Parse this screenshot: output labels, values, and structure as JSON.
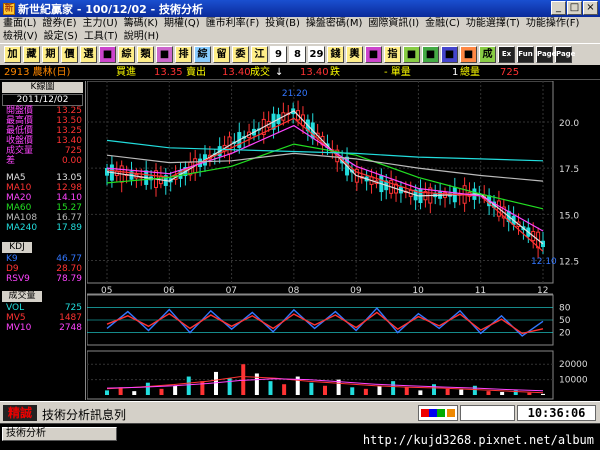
{
  "window": {
    "title": "新世紀贏家 - 100/12/02 - 技術分析",
    "app_icon": "app-icon",
    "controls": [
      "_",
      "□",
      "×"
    ]
  },
  "menu": {
    "row1": [
      "畫面(L)",
      "證券(E)",
      "主力(U)",
      "籌碼(K)",
      "期權(Q)",
      "匯市利率(F)",
      "投資(B)",
      "操盤密碼(M)",
      "國際資訊(I)",
      "金融(C)",
      "功能選擇(T)",
      "功能操作(F)"
    ],
    "row2": [
      "檢視(V)",
      "設定(S)",
      "工具(T)",
      "說明(H)"
    ]
  },
  "toolbar": [
    "加",
    "藏",
    "期",
    "價",
    "選",
    "■",
    "綜",
    "類",
    "■",
    "排",
    "綜",
    "留",
    "委",
    "江",
    "9",
    "8",
    "29",
    "錢",
    "輿",
    "■",
    "指",
    "■",
    "■",
    "■",
    "■",
    "成",
    "Ex",
    "Fun",
    "Page",
    "Page"
  ],
  "quote": {
    "code": "2913 農林(日)",
    "buy_label": "買進",
    "buy": "13.35",
    "sell_label": "賣出",
    "sell": "13.40",
    "last_label": "成交",
    "arrow": "↓",
    "last": "13.40",
    "change_label": "跌",
    "unit_label": "- 單量",
    "unit": "1",
    "vol_label": "總量",
    "volume": "725"
  },
  "panel": {
    "title": "K線圖",
    "date": "2011/12/02",
    "ohlc": [
      {
        "label": "開盤價",
        "value": "13.25"
      },
      {
        "label": "最高價",
        "value": "13.50"
      },
      {
        "label": "最低價",
        "value": "13.25"
      },
      {
        "label": "收盤價",
        "value": "13.40"
      },
      {
        "label": "成交量",
        "value": "725"
      },
      {
        "label": "差",
        "value": "0.00"
      }
    ],
    "ma": [
      {
        "label": "MA5",
        "value": "13.05",
        "color": "#e0e0e0"
      },
      {
        "label": "MA10",
        "value": "12.98",
        "color": "#ff3333"
      },
      {
        "label": "MA20",
        "value": "14.10",
        "color": "#ff44ff"
      },
      {
        "label": "MA60",
        "value": "15.27",
        "color": "#22dd22"
      },
      {
        "label": "MA108",
        "value": "16.77",
        "color": "#bbbbbb"
      },
      {
        "label": "MA240",
        "value": "17.89",
        "color": "#22dddd"
      }
    ],
    "kdj_title": "KDJ",
    "kdj": [
      {
        "label": "K9",
        "value": "46.77",
        "color": "#3377ff"
      },
      {
        "label": "D9",
        "value": "28.70",
        "color": "#ff3333"
      },
      {
        "label": "RSV9",
        "value": "78.79",
        "color": "#ff44ff"
      }
    ],
    "vol_title": "成交量",
    "vol": [
      {
        "label": "VOL",
        "value": "725",
        "color": "#22dddd"
      },
      {
        "label": "MV5",
        "value": "1487",
        "color": "#ff3333"
      },
      {
        "label": "MV10",
        "value": "2748",
        "color": "#ff44ff"
      }
    ]
  },
  "chart_data": {
    "type": "line",
    "x": [
      "05",
      "06",
      "07",
      "08",
      "09",
      "10",
      "11",
      "12"
    ],
    "ylim": [
      11.5,
      22.0
    ],
    "y_ticks": [
      "20.0",
      "17.5",
      "15.0",
      "12.5"
    ],
    "annotations": [
      {
        "text": "21.20",
        "x": "08",
        "y": 21.2
      },
      {
        "text": "12.10",
        "x": "12",
        "y": 12.1
      }
    ],
    "price_series": [
      {
        "name": "MA5",
        "color": "#e0e0e0",
        "values": [
          17.3,
          16.8,
          18.8,
          20.6,
          17.1,
          16.0,
          16.1,
          13.4
        ]
      },
      {
        "name": "MA10",
        "color": "#ff3333",
        "values": [
          17.4,
          17.0,
          18.6,
          20.2,
          17.3,
          16.2,
          16.0,
          13.0
        ]
      },
      {
        "name": "MA20",
        "color": "#ff44ff",
        "values": [
          17.5,
          17.2,
          18.3,
          19.8,
          17.6,
          16.4,
          16.0,
          14.1
        ]
      },
      {
        "name": "MA60",
        "color": "#22dd22",
        "values": [
          16.7,
          17.0,
          17.6,
          18.8,
          18.2,
          17.0,
          16.1,
          15.3
        ]
      },
      {
        "name": "MA108",
        "color": "#bbbbbb",
        "values": [
          18.2,
          17.8,
          17.9,
          18.3,
          18.0,
          17.5,
          17.1,
          16.8
        ]
      },
      {
        "name": "MA240",
        "color": "#22dddd",
        "values": [
          19.0,
          18.6,
          18.5,
          18.4,
          18.3,
          18.1,
          18.0,
          17.9
        ]
      }
    ],
    "kdj_ticks": [
      "80",
      "50",
      "20"
    ],
    "kdj_ylim": [
      0,
      100
    ],
    "kdj_series": [
      {
        "name": "K9",
        "color": "#3377ff",
        "values": [
          30,
          70,
          25,
          75,
          20,
          72,
          28,
          68,
          22,
          74,
          30,
          70,
          25,
          78,
          20,
          65,
          30,
          72,
          18,
          60,
          12,
          47
        ]
      },
      {
        "name": "D9",
        "color": "#ff3333",
        "values": [
          40,
          60,
          35,
          65,
          30,
          62,
          35,
          60,
          30,
          64,
          38,
          62,
          32,
          68,
          28,
          58,
          36,
          64,
          26,
          52,
          18,
          29
        ]
      }
    ],
    "vol_ticks": [
      "20000",
      "10000"
    ],
    "vol_ylim": [
      0,
      26000
    ],
    "volumes": [
      3000,
      5000,
      2500,
      8000,
      4000,
      6000,
      12000,
      9000,
      15000,
      11000,
      20000,
      14000,
      9000,
      7000,
      12000,
      8000,
      6000,
      10000,
      5000,
      4000,
      6000,
      9000,
      5000,
      3000,
      7000,
      4000,
      3500,
      6000,
      2500,
      2000,
      3000,
      1500,
      725
    ],
    "mv5": [
      4000,
      5200,
      6800,
      9000,
      12000,
      11000,
      9000,
      7500,
      6000,
      5000,
      4500,
      3500,
      2500,
      1487
    ],
    "mv10": [
      4500,
      5000,
      6000,
      7500,
      9500,
      10500,
      10000,
      8500,
      7000,
      6000,
      5200,
      4500,
      3500,
      2748
    ]
  },
  "status": {
    "brand": "精誠",
    "message": "技術分析訊息列",
    "clock": "10:36:06"
  },
  "taskbar": {
    "title": "技術分析",
    "watermark": "http://kujd3268.pixnet.net/album"
  }
}
